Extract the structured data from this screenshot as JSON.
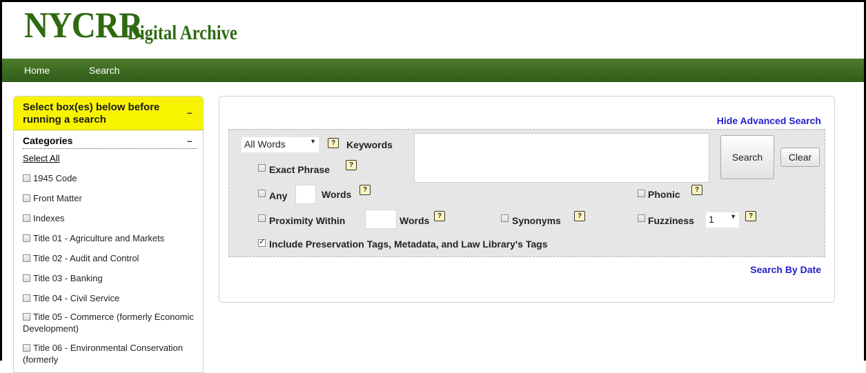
{
  "logo": {
    "main": "NYCRR",
    "sub": "Digital Archive"
  },
  "nav": {
    "home": "Home",
    "search": "Search"
  },
  "sidebar": {
    "instruction": "Select box(es) below before running a search",
    "collapse_symbol": "–",
    "categories_title": "Categories",
    "select_all": "Select All",
    "items": [
      "1945 Code",
      "Front Matter",
      "Indexes",
      "Title 01 - Agriculture and Markets",
      "Title 02 - Audit and Control",
      "Title 03 - Banking",
      "Title 04 - Civil Service",
      "Title 05 - Commerce (formerly Economic Development)",
      "Title 06 - Environmental Conservation (formerly"
    ]
  },
  "search": {
    "hide_advanced": "Hide Advanced Search",
    "search_by_date": "Search By Date",
    "mode_select": "All Words",
    "keywords_label": "Keywords",
    "help_glyph": "?",
    "exact_phrase": "Exact Phrase",
    "any": "Any",
    "words": "Words",
    "phonic": "Phonic",
    "proximity_within": "Proximity Within",
    "synonyms": "Synonyms",
    "fuzziness": "Fuzziness",
    "fuzziness_value": "1",
    "include_tags": "Include Preservation Tags, Metadata, and Law Library's Tags",
    "search_button": "Search",
    "clear_button": "Clear"
  },
  "colors": {
    "brand_green": "#2f6a12",
    "nav_green": "#3f6e22",
    "highlight_yellow": "#f8f400",
    "link_blue": "#1f1fcc"
  }
}
